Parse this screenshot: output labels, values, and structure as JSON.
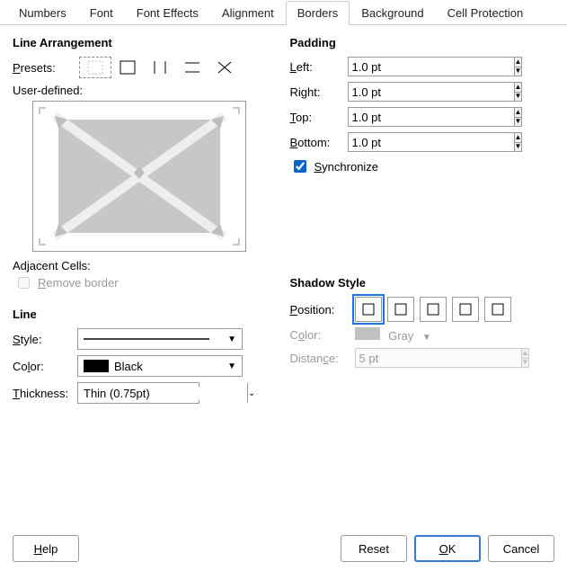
{
  "tabs": [
    "Numbers",
    "Font",
    "Font Effects",
    "Alignment",
    "Borders",
    "Background",
    "Cell Protection"
  ],
  "active_tab_index": 4,
  "lineArrangement": {
    "heading": "Line Arrangement",
    "presets_label": "Presets:",
    "userdef_label": "User-defined:",
    "adjacent_label": "Adjacent Cells:",
    "remove_label": "Remove border",
    "selected_preset": 0
  },
  "line": {
    "heading": "Line",
    "style_label": "Style:",
    "color_label": "Color:",
    "thickness_label": "Thickness:",
    "color_name": "Black",
    "color_hex": "#000000",
    "thickness_value": "Thin (0.75pt)"
  },
  "padding": {
    "heading": "Padding",
    "left_label": "Left:",
    "right_label": "Right:",
    "top_label": "Top:",
    "bottom_label": "Bottom:",
    "left": "1.0 pt",
    "right": "1.0 pt",
    "top": "1.0 pt",
    "bottom": "1.0 pt",
    "sync_label": "Synchronize",
    "sync": true
  },
  "shadow": {
    "heading": "Shadow Style",
    "position_label": "Position:",
    "color_label": "Color:",
    "distance_label": "Distance:",
    "color_name": "Gray",
    "distance": "5 pt",
    "selected_pos": 0
  },
  "footer": {
    "help": "Help",
    "reset": "Reset",
    "ok": "OK",
    "cancel": "Cancel"
  }
}
